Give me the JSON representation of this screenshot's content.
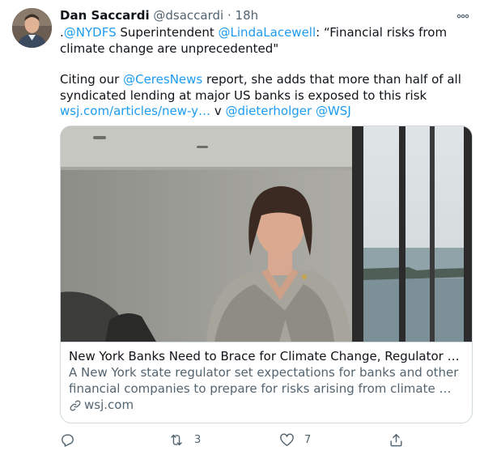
{
  "tweet": {
    "author_name": "Dan Saccardi",
    "author_handle": "@dsaccardi",
    "separator": "·",
    "time": "18h",
    "line1": {
      "prefix": ".",
      "mention1": "@NYDFS",
      "mid1": " Superintendent ",
      "mention2": "@LindaLacewell",
      "quote": ": “Financial risks from climate change are unprecedented\""
    },
    "line2": {
      "prefix": "Citing our ",
      "mention": "@CeresNews",
      "body": " report, she adds that more than half of all syndicated lending at major US banks is exposed to this risk ",
      "url": "wsj.com/articles/new-y…",
      "via": " v ",
      "mention2": "@dieterholger",
      "space": " ",
      "mention3": "@WSJ"
    }
  },
  "card": {
    "title": "New York Banks Need to Brace for Climate Change, Regulator …",
    "description": "A New York state regulator set expectations for banks and other financial companies to prepare for risks arising from climate …",
    "domain": "wsj.com",
    "icon": "link-icon"
  },
  "actions": {
    "reply": {
      "icon": "reply-icon",
      "count": ""
    },
    "retweet": {
      "icon": "retweet-icon",
      "count": "3"
    },
    "like": {
      "icon": "heart-icon",
      "count": "7"
    },
    "share": {
      "icon": "share-icon",
      "count": ""
    }
  },
  "colors": {
    "link": "#1d9bf0",
    "secondary_text": "#536471",
    "primary_text": "#0f1419",
    "border": "#cfd9de"
  }
}
